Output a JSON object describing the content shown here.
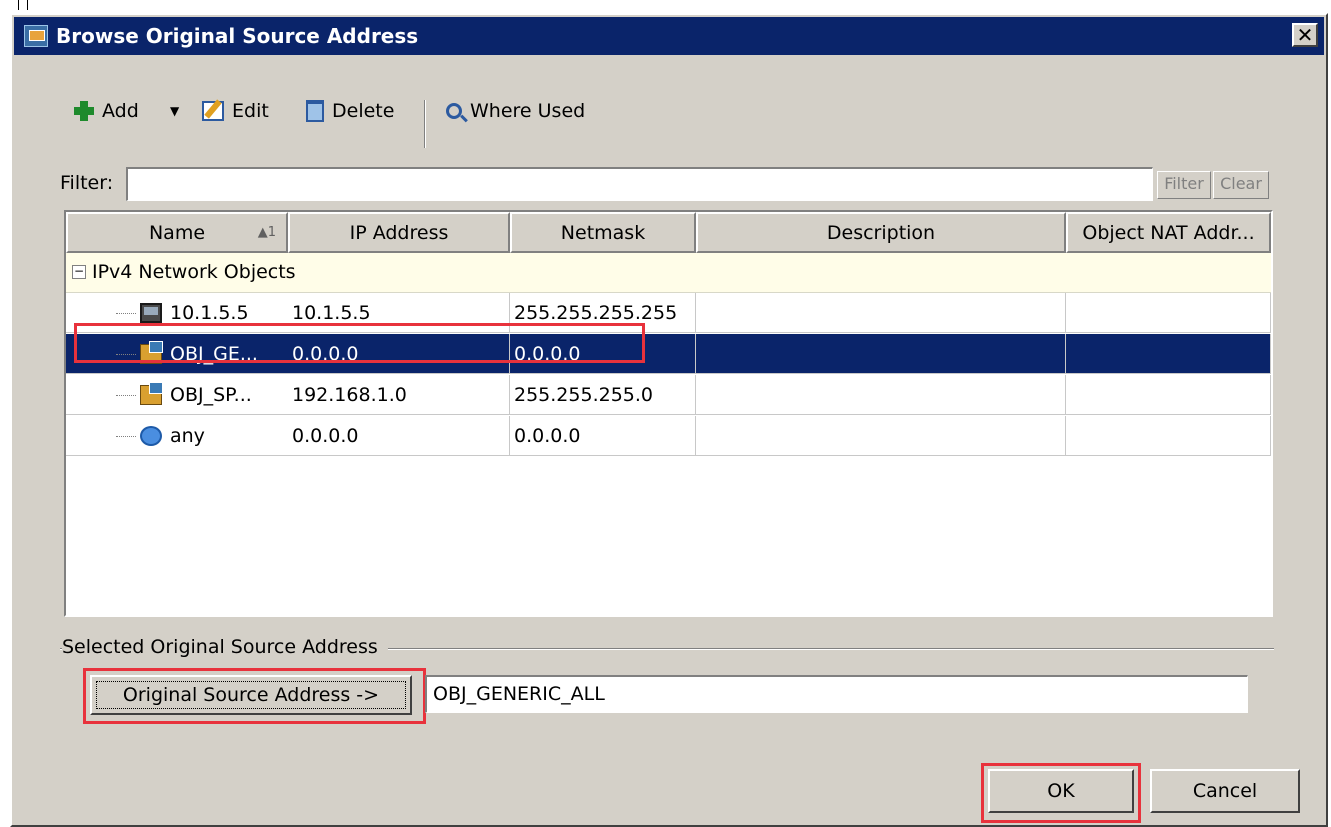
{
  "window": {
    "title": "Browse Original Source Address",
    "close_glyph": "✕"
  },
  "toolbar": {
    "add_label": "Add",
    "add_dropdown_glyph": "▼",
    "edit_label": "Edit",
    "delete_label": "Delete",
    "where_used_label": "Where Used"
  },
  "filter": {
    "label": "Filter:",
    "value": "",
    "filter_button": "Filter",
    "clear_button": "Clear"
  },
  "table": {
    "columns": [
      "Name",
      "IP Address",
      "Netmask",
      "Description",
      "Object NAT Addr..."
    ],
    "sort_indicator": "▲1",
    "group": {
      "toggle": "−",
      "label": "IPv4 Network Objects"
    },
    "rows": [
      {
        "icon": "host-icon",
        "name": "10.1.5.5",
        "ip": "10.1.5.5",
        "netmask": "255.255.255.255",
        "description": "",
        "nat": ""
      },
      {
        "icon": "network-object-icon",
        "name": "OBJ_GE...",
        "ip": "0.0.0.0",
        "netmask": "0.0.0.0",
        "description": "",
        "nat": "",
        "selected": true
      },
      {
        "icon": "network-icon",
        "name": "OBJ_SP...",
        "ip": "192.168.1.0",
        "netmask": "255.255.255.0",
        "description": "",
        "nat": ""
      },
      {
        "icon": "any-cloud-icon",
        "name": "any",
        "ip": "0.0.0.0",
        "netmask": "0.0.0.0",
        "description": "",
        "nat": ""
      }
    ]
  },
  "selection": {
    "legend": "Selected Original Source Address",
    "button_label": "Original Source Address ->",
    "value": "OBJ_GENERIC_ALL"
  },
  "dialog_buttons": {
    "ok": "OK",
    "cancel": "Cancel"
  },
  "colors": {
    "titlebar": "#0a246a",
    "selection": "#0a246a",
    "annotation": "#e8323c",
    "dialog_bg": "#d4d0c8",
    "group_row": "#fffde8"
  }
}
